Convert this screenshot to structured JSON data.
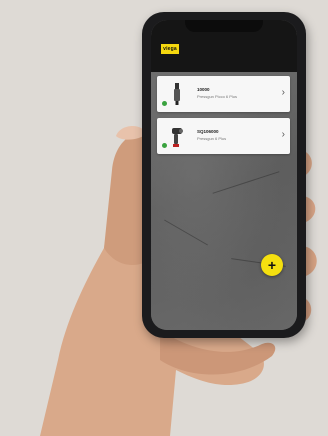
{
  "app": {
    "logo_text": "viega"
  },
  "devices": [
    {
      "id": "10000",
      "name": "Pressgun Picco 6 Plus",
      "status_color": "#3aa33f",
      "icon": "press-tool-icon"
    },
    {
      "id": "SQ106000",
      "name": "Pressgun 6 Plus",
      "status_color": "#3aa33f",
      "icon": "press-gun-icon"
    }
  ],
  "actions": {
    "add_label": "+"
  },
  "colors": {
    "brand_yellow": "#f5d80f",
    "status_green": "#3aa33f",
    "header_dark": "#151515"
  }
}
